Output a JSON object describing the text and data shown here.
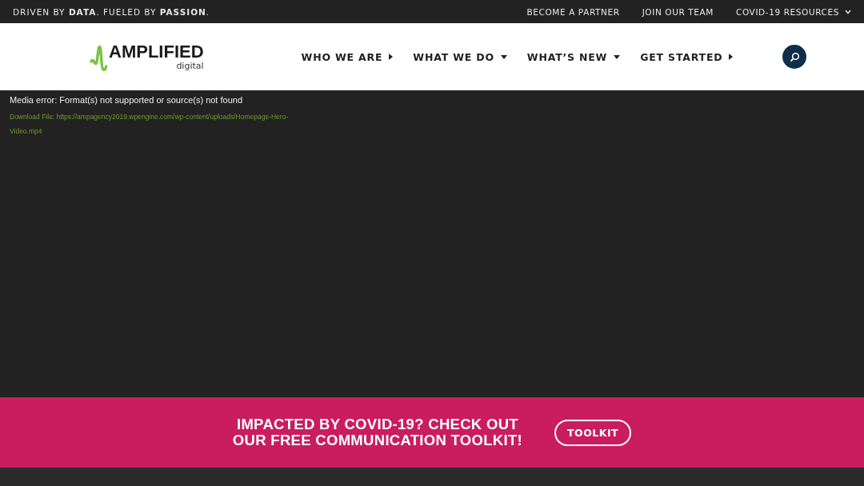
{
  "top_bar": {
    "tagline": "DRIVEN BY **DATA**. FUELED BY **PASSION**.",
    "links": [
      {
        "label": "BECOME A PARTNER",
        "kind": "plain"
      },
      {
        "label": "JOIN OUR TEAM",
        "kind": "plain"
      },
      {
        "label": "COVID-19 RESOURCES",
        "kind": "dropdown"
      }
    ]
  },
  "header": {
    "logo": {
      "name": "AMPLIFIED",
      "sub": "digital"
    },
    "nav": [
      {
        "label": "WHO WE ARE",
        "kind": "submenu"
      },
      {
        "label": "WHAT WE DO",
        "kind": "dropdown"
      },
      {
        "label": "WHAT’S NEW",
        "kind": "dropdown"
      },
      {
        "label": "GET STARTED",
        "kind": "submenu"
      }
    ]
  },
  "video": {
    "error": "Media error: Format(s) not supported or source(s) not found",
    "download": "Download File: https://ampagency2019.wpengine.com/wp-content/uploads/Homepage-Hero-Video.mp4"
  },
  "banner": {
    "heading_lines": [
      "IMPACTED BY COVID-19? CHECK OUT",
      "OUR FREE COMMUNICATION TOOLKIT!"
    ],
    "button": "TOOLKIT"
  }
}
